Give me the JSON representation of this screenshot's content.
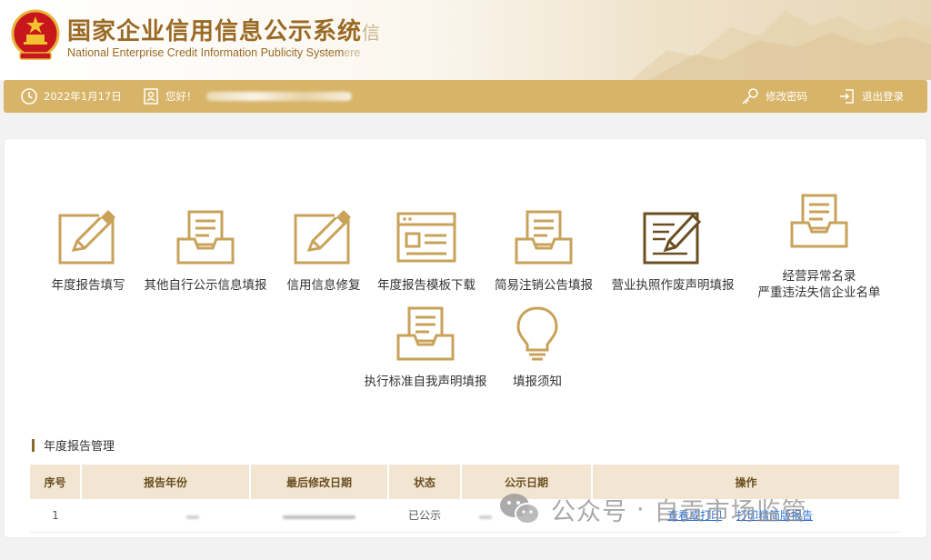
{
  "header": {
    "title_cn": "国家企业信用信息公示系统",
    "title_cn_tail": "信",
    "title_en": "National Enterprise Credit Information Publicity System",
    "title_en_tail": "ere"
  },
  "bar": {
    "date": "2022年1月17日",
    "greeting": "您好！",
    "change_password": "修改密码",
    "logout": "退出登录"
  },
  "functions": [
    {
      "label": "年度报告填写"
    },
    {
      "label": "其他自行公示信息填报"
    },
    {
      "label": "信用信息修复"
    },
    {
      "label": "年度报告模板下载"
    },
    {
      "label": "简易注销公告填报"
    },
    {
      "label": "营业执照作废声明填报"
    },
    {
      "label": "经营异常名录",
      "label2": "严重违法失信企业名单"
    },
    {
      "label": "执行标准自我声明填报"
    },
    {
      "label": "填报须知"
    }
  ],
  "section": {
    "title": "年度报告管理"
  },
  "table": {
    "headers": [
      "序号",
      "报告年份",
      "最后修改日期",
      "状态",
      "公示日期",
      "操作"
    ],
    "rows": [
      {
        "index": "1",
        "status": "已公示",
        "action1": "查看或打印",
        "action2": "打印精简版报告"
      }
    ]
  },
  "watermark": {
    "platform": "公众号",
    "gap": "·",
    "name": "自贡市场监管"
  },
  "colors": {
    "gold": "#d8b468",
    "brown": "#9a6a24",
    "table_header": "#f2e6d2",
    "link": "#2b6fd6"
  }
}
